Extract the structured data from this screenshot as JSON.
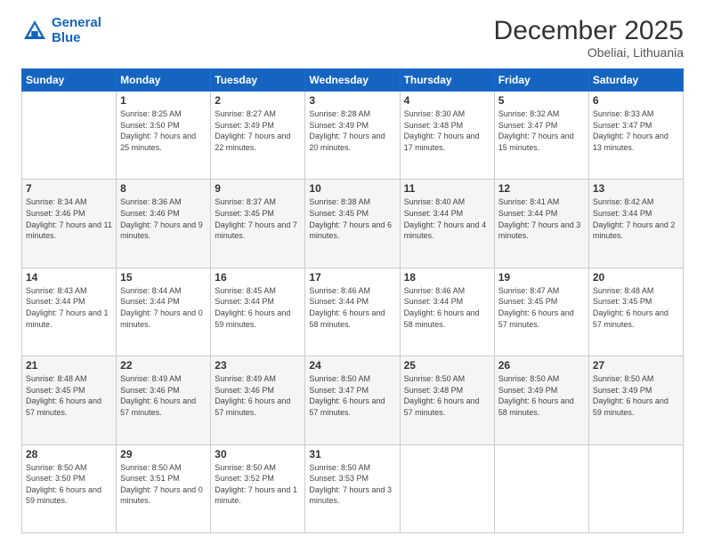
{
  "logo": {
    "line1": "General",
    "line2": "Blue"
  },
  "title": "December 2025",
  "subtitle": "Obeliai, Lithuania",
  "days_header": [
    "Sunday",
    "Monday",
    "Tuesday",
    "Wednesday",
    "Thursday",
    "Friday",
    "Saturday"
  ],
  "weeks": [
    [
      {
        "num": "",
        "sunrise": "",
        "sunset": "",
        "daylight": ""
      },
      {
        "num": "1",
        "sunrise": "Sunrise: 8:25 AM",
        "sunset": "Sunset: 3:50 PM",
        "daylight": "Daylight: 7 hours and 25 minutes."
      },
      {
        "num": "2",
        "sunrise": "Sunrise: 8:27 AM",
        "sunset": "Sunset: 3:49 PM",
        "daylight": "Daylight: 7 hours and 22 minutes."
      },
      {
        "num": "3",
        "sunrise": "Sunrise: 8:28 AM",
        "sunset": "Sunset: 3:49 PM",
        "daylight": "Daylight: 7 hours and 20 minutes."
      },
      {
        "num": "4",
        "sunrise": "Sunrise: 8:30 AM",
        "sunset": "Sunset: 3:48 PM",
        "daylight": "Daylight: 7 hours and 17 minutes."
      },
      {
        "num": "5",
        "sunrise": "Sunrise: 8:32 AM",
        "sunset": "Sunset: 3:47 PM",
        "daylight": "Daylight: 7 hours and 15 minutes."
      },
      {
        "num": "6",
        "sunrise": "Sunrise: 8:33 AM",
        "sunset": "Sunset: 3:47 PM",
        "daylight": "Daylight: 7 hours and 13 minutes."
      }
    ],
    [
      {
        "num": "7",
        "sunrise": "Sunrise: 8:34 AM",
        "sunset": "Sunset: 3:46 PM",
        "daylight": "Daylight: 7 hours and 11 minutes."
      },
      {
        "num": "8",
        "sunrise": "Sunrise: 8:36 AM",
        "sunset": "Sunset: 3:46 PM",
        "daylight": "Daylight: 7 hours and 9 minutes."
      },
      {
        "num": "9",
        "sunrise": "Sunrise: 8:37 AM",
        "sunset": "Sunset: 3:45 PM",
        "daylight": "Daylight: 7 hours and 7 minutes."
      },
      {
        "num": "10",
        "sunrise": "Sunrise: 8:38 AM",
        "sunset": "Sunset: 3:45 PM",
        "daylight": "Daylight: 7 hours and 6 minutes."
      },
      {
        "num": "11",
        "sunrise": "Sunrise: 8:40 AM",
        "sunset": "Sunset: 3:44 PM",
        "daylight": "Daylight: 7 hours and 4 minutes."
      },
      {
        "num": "12",
        "sunrise": "Sunrise: 8:41 AM",
        "sunset": "Sunset: 3:44 PM",
        "daylight": "Daylight: 7 hours and 3 minutes."
      },
      {
        "num": "13",
        "sunrise": "Sunrise: 8:42 AM",
        "sunset": "Sunset: 3:44 PM",
        "daylight": "Daylight: 7 hours and 2 minutes."
      }
    ],
    [
      {
        "num": "14",
        "sunrise": "Sunrise: 8:43 AM",
        "sunset": "Sunset: 3:44 PM",
        "daylight": "Daylight: 7 hours and 1 minute."
      },
      {
        "num": "15",
        "sunrise": "Sunrise: 8:44 AM",
        "sunset": "Sunset: 3:44 PM",
        "daylight": "Daylight: 7 hours and 0 minutes."
      },
      {
        "num": "16",
        "sunrise": "Sunrise: 8:45 AM",
        "sunset": "Sunset: 3:44 PM",
        "daylight": "Daylight: 6 hours and 59 minutes."
      },
      {
        "num": "17",
        "sunrise": "Sunrise: 8:46 AM",
        "sunset": "Sunset: 3:44 PM",
        "daylight": "Daylight: 6 hours and 58 minutes."
      },
      {
        "num": "18",
        "sunrise": "Sunrise: 8:46 AM",
        "sunset": "Sunset: 3:44 PM",
        "daylight": "Daylight: 6 hours and 58 minutes."
      },
      {
        "num": "19",
        "sunrise": "Sunrise: 8:47 AM",
        "sunset": "Sunset: 3:45 PM",
        "daylight": "Daylight: 6 hours and 57 minutes."
      },
      {
        "num": "20",
        "sunrise": "Sunrise: 8:48 AM",
        "sunset": "Sunset: 3:45 PM",
        "daylight": "Daylight: 6 hours and 57 minutes."
      }
    ],
    [
      {
        "num": "21",
        "sunrise": "Sunrise: 8:48 AM",
        "sunset": "Sunset: 3:45 PM",
        "daylight": "Daylight: 6 hours and 57 minutes."
      },
      {
        "num": "22",
        "sunrise": "Sunrise: 8:49 AM",
        "sunset": "Sunset: 3:46 PM",
        "daylight": "Daylight: 6 hours and 57 minutes."
      },
      {
        "num": "23",
        "sunrise": "Sunrise: 8:49 AM",
        "sunset": "Sunset: 3:46 PM",
        "daylight": "Daylight: 6 hours and 57 minutes."
      },
      {
        "num": "24",
        "sunrise": "Sunrise: 8:50 AM",
        "sunset": "Sunset: 3:47 PM",
        "daylight": "Daylight: 6 hours and 57 minutes."
      },
      {
        "num": "25",
        "sunrise": "Sunrise: 8:50 AM",
        "sunset": "Sunset: 3:48 PM",
        "daylight": "Daylight: 6 hours and 57 minutes."
      },
      {
        "num": "26",
        "sunrise": "Sunrise: 8:50 AM",
        "sunset": "Sunset: 3:49 PM",
        "daylight": "Daylight: 6 hours and 58 minutes."
      },
      {
        "num": "27",
        "sunrise": "Sunrise: 8:50 AM",
        "sunset": "Sunset: 3:49 PM",
        "daylight": "Daylight: 6 hours and 59 minutes."
      }
    ],
    [
      {
        "num": "28",
        "sunrise": "Sunrise: 8:50 AM",
        "sunset": "Sunset: 3:50 PM",
        "daylight": "Daylight: 6 hours and 59 minutes."
      },
      {
        "num": "29",
        "sunrise": "Sunrise: 8:50 AM",
        "sunset": "Sunset: 3:51 PM",
        "daylight": "Daylight: 7 hours and 0 minutes."
      },
      {
        "num": "30",
        "sunrise": "Sunrise: 8:50 AM",
        "sunset": "Sunset: 3:52 PM",
        "daylight": "Daylight: 7 hours and 1 minute."
      },
      {
        "num": "31",
        "sunrise": "Sunrise: 8:50 AM",
        "sunset": "Sunset: 3:53 PM",
        "daylight": "Daylight: 7 hours and 3 minutes."
      },
      {
        "num": "",
        "sunrise": "",
        "sunset": "",
        "daylight": ""
      },
      {
        "num": "",
        "sunrise": "",
        "sunset": "",
        "daylight": ""
      },
      {
        "num": "",
        "sunrise": "",
        "sunset": "",
        "daylight": ""
      }
    ]
  ]
}
